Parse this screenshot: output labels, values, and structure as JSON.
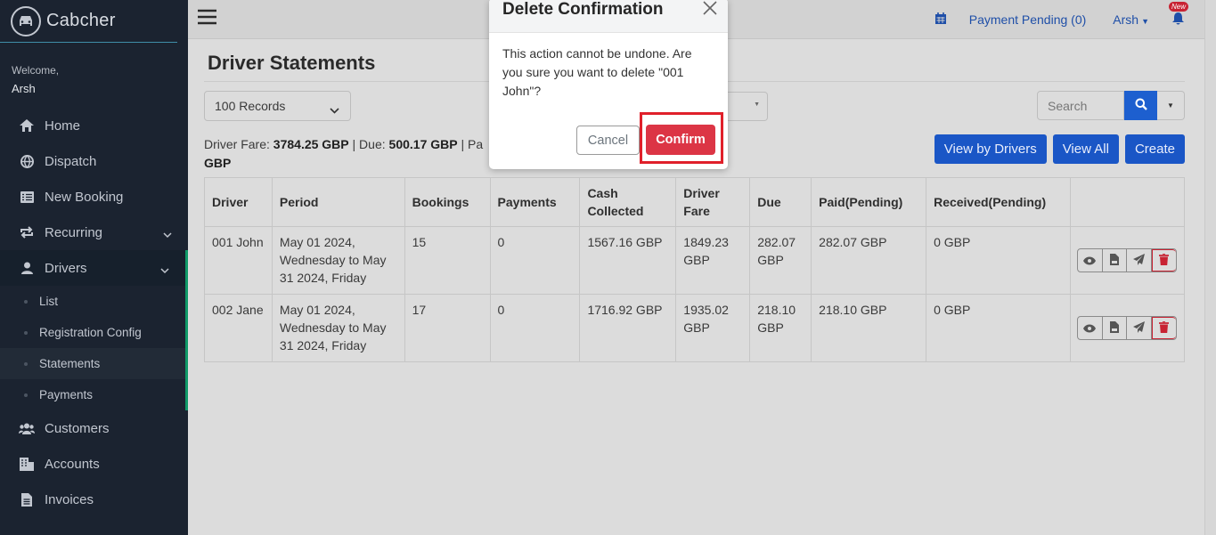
{
  "brand": {
    "name": "Cabcher",
    "logo_icon": "car-icon"
  },
  "sidebar": {
    "welcome": "Welcome,",
    "user": "Arsh",
    "items": [
      {
        "label": "Home",
        "icon": "home-icon"
      },
      {
        "label": "Dispatch",
        "icon": "globe-icon"
      },
      {
        "label": "New Booking",
        "icon": "list-icon"
      },
      {
        "label": "Recurring",
        "icon": "repeat-icon"
      },
      {
        "label": "Drivers",
        "icon": "user-icon"
      },
      {
        "label": "Customers",
        "icon": "users-icon"
      },
      {
        "label": "Accounts",
        "icon": "building-icon"
      },
      {
        "label": "Invoices",
        "icon": "file-icon"
      }
    ],
    "sub_items": [
      {
        "label": "List"
      },
      {
        "label": "Registration Config"
      },
      {
        "label": "Statements"
      },
      {
        "label": "Payments"
      }
    ]
  },
  "topbar": {
    "payment_pending": "Payment Pending (0)",
    "user_menu": "Arsh",
    "bell_badge": "New"
  },
  "page": {
    "title": "Driver Statements",
    "records_select": "100 Records",
    "search_placeholder": "Search",
    "summary": {
      "driver_fare_label": "Driver Fare:",
      "driver_fare_value": "3784.25 GBP",
      "sep1": "| Due:",
      "due_value": "500.17 GBP",
      "tail": "| Pa",
      "wrap": "GBP"
    },
    "buttons": {
      "view_by_drivers": "View by Drivers",
      "view_all": "View All",
      "create": "Create"
    }
  },
  "table": {
    "headers": [
      "Driver",
      "Period",
      "Bookings",
      "Payments",
      "Cash Collected",
      "Driver Fare",
      "Due",
      "Paid(Pending)",
      "Received(Pending)",
      ""
    ],
    "rows": [
      {
        "driver": "001 John",
        "period": "May 01 2024, Wednesday to May 31 2024, Friday",
        "bookings": "15",
        "payments": "0",
        "cash": "1567.16 GBP",
        "fare": "1849.23 GBP",
        "due": "282.07 GBP",
        "paid": "282.07 GBP",
        "received": "0 GBP"
      },
      {
        "driver": "002 Jane",
        "period": "May 01 2024, Wednesday to May 31 2024, Friday",
        "bookings": "17",
        "payments": "0",
        "cash": "1716.92 GBP",
        "fare": "1935.02 GBP",
        "due": "218.10 GBP",
        "paid": "218.10 GBP",
        "received": "0 GBP"
      }
    ]
  },
  "modal": {
    "title": "Delete Confirmation",
    "body": "This action cannot be undone. Are you sure you want to delete \"001 John\"?",
    "cancel": "Cancel",
    "confirm": "Confirm"
  },
  "colors": {
    "sidebar_bg": "#1b2330",
    "primary": "#1a56c6",
    "danger": "#dc3545",
    "active_bar": "#0f9a68"
  }
}
